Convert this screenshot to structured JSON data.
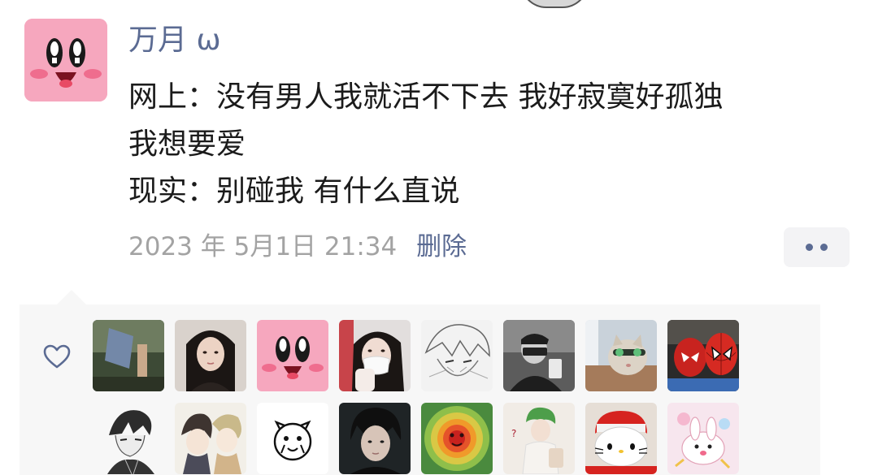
{
  "post": {
    "username": "万月 ω",
    "lines": [
      "网上：没有男人我就活不下去 我好寂寞好孤独",
      "我想要爱",
      "现实：别碰我  有什么直说"
    ],
    "timestamp": "2023 年 5月1日 21:34",
    "delete_label": "删除"
  },
  "likes": {
    "icon": "heart-outline-icon",
    "avatars": [
      {
        "name": "liker-avatar-1",
        "icon": "photo-avatar"
      },
      {
        "name": "liker-avatar-2",
        "icon": "photo-avatar"
      },
      {
        "name": "liker-avatar-3",
        "icon": "kirby-avatar"
      },
      {
        "name": "liker-avatar-4",
        "icon": "photo-avatar"
      },
      {
        "name": "liker-avatar-5",
        "icon": "sketch-avatar"
      },
      {
        "name": "liker-avatar-6",
        "icon": "photo-avatar"
      },
      {
        "name": "liker-avatar-7",
        "icon": "cat-photo-avatar"
      },
      {
        "name": "liker-avatar-8",
        "icon": "spiderman-avatar"
      },
      {
        "name": "liker-avatar-9",
        "icon": "anime-sketch-avatar"
      },
      {
        "name": "liker-avatar-10",
        "icon": "anime-avatar"
      },
      {
        "name": "liker-avatar-11",
        "icon": "doodle-avatar"
      },
      {
        "name": "liker-avatar-12",
        "icon": "photo-avatar"
      },
      {
        "name": "liker-avatar-13",
        "icon": "psychedelic-avatar"
      },
      {
        "name": "liker-avatar-14",
        "icon": "photo-avatar"
      },
      {
        "name": "liker-avatar-15",
        "icon": "hello-kitty-avatar"
      },
      {
        "name": "liker-avatar-16",
        "icon": "cartoon-avatar"
      }
    ]
  },
  "colors": {
    "name_blue": "#5b6b93",
    "meta_gray": "#a3a3a3",
    "panel_bg": "#f7f7f7",
    "kirby_pink": "#f6a7be"
  }
}
